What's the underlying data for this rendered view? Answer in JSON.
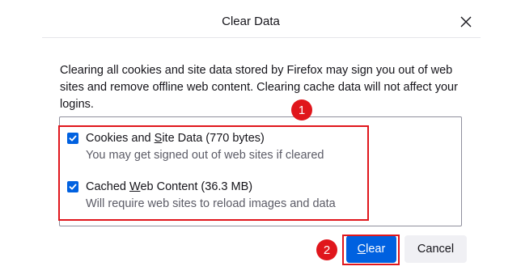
{
  "dialog": {
    "title": "Clear Data",
    "description": "Clearing all cookies and site data stored by Firefox may sign you out of web sites and remove offline web content. Clearing cache data will not affect your logins."
  },
  "options": [
    {
      "label_pre": "Cookies and ",
      "label_accesskey": "S",
      "label_post": "ite Data (770 bytes)",
      "description": "You may get signed out of web sites if cleared",
      "checked": true
    },
    {
      "label_pre": "Cached ",
      "label_accesskey": "W",
      "label_post": "eb Content (36.3 MB)",
      "description": "Will require web sites to reload images and data",
      "checked": true
    }
  ],
  "buttons": {
    "clear_accesskey": "C",
    "clear_rest": "lear",
    "cancel": "Cancel"
  },
  "annotations": {
    "marker1": "1",
    "marker2": "2",
    "color": "#e0161c"
  },
  "colors": {
    "accent": "#0061e0",
    "secondary_text": "#5b5b66"
  },
  "icons": {
    "close": "close-icon",
    "check": "checkmark-icon"
  }
}
